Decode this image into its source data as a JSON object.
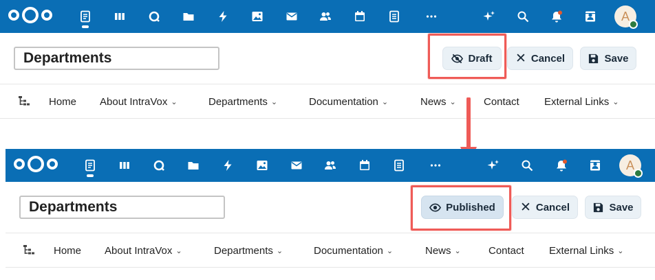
{
  "top_state": {
    "page_title": "Departments",
    "draft_label": "Draft",
    "cancel_label": "Cancel",
    "save_label": "Save"
  },
  "bottom_state": {
    "page_title": "Departments",
    "published_label": "Published",
    "cancel_label": "Cancel",
    "save_label": "Save"
  },
  "nav": {
    "home": "Home",
    "about": "About IntraVox",
    "departments": "Departments",
    "documentation": "Documentation",
    "news": "News",
    "contact": "Contact",
    "external_links": "External Links",
    "chevron": "⌄"
  },
  "user": {
    "avatar_initial": "A"
  },
  "icons": [
    "intravox-icon",
    "deck-icon",
    "talk-icon",
    "files-icon",
    "activity-icon",
    "photos-icon",
    "mail-icon",
    "contacts-icon",
    "calendar-icon",
    "notes-icon",
    "more-apps-icon",
    "assistant-icon",
    "search-icon",
    "notifications-icon",
    "contacts-menu-icon"
  ],
  "colors": {
    "header_bg": "#0a6eb5",
    "highlight_red": "#ef5b57",
    "button_bg": "#eaf1f6",
    "published_bg": "#d6e4f0",
    "status_online": "#2d7b41"
  }
}
